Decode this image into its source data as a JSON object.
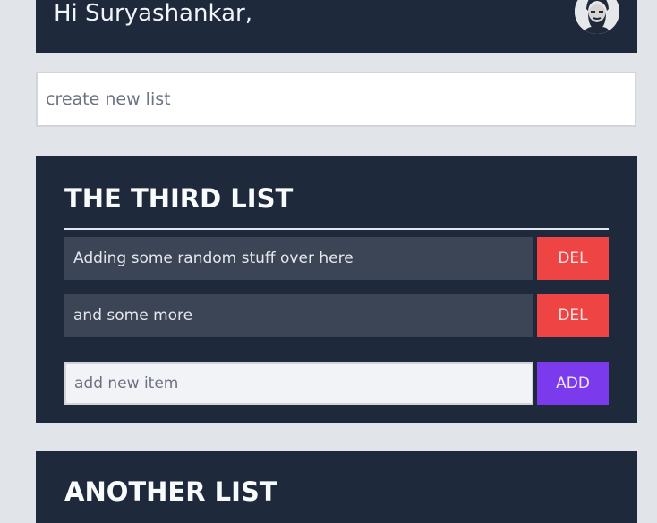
{
  "header": {
    "greeting": "Hi Suryashankar,"
  },
  "new_list": {
    "placeholder": "create new list",
    "value": ""
  },
  "lists": [
    {
      "title": "THE THIRD LIST",
      "items": [
        {
          "text": "Adding some random stuff over here",
          "delete_label": "DEL"
        },
        {
          "text": "and some more",
          "delete_label": "DEL"
        }
      ],
      "add_item": {
        "placeholder": "add new item",
        "value": "",
        "button_label": "ADD"
      }
    },
    {
      "title": "ANOTHER LIST"
    }
  ],
  "colors": {
    "card_background": "#1e293b",
    "page_background": "#e1e4e9",
    "item_background": "#3b4556",
    "delete_button": "#ef4444",
    "add_button": "#7c3aed"
  },
  "icons": {
    "avatar": "user-avatar-icon"
  }
}
